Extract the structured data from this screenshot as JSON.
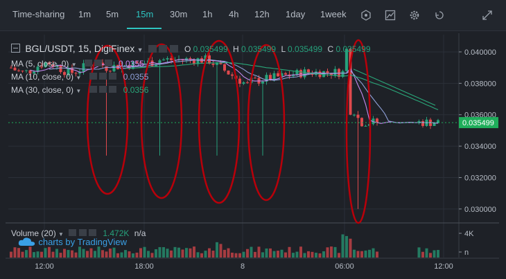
{
  "toolbar": {
    "timeframes": [
      "Time-sharing",
      "1m",
      "5m",
      "15m",
      "30m",
      "1h",
      "4h",
      "12h",
      "1day",
      "1week"
    ],
    "active": "15m",
    "icons": [
      "hexagon-icon",
      "chart-line-icon",
      "gear-icon",
      "undo-icon",
      "expand-icon"
    ]
  },
  "legend": {
    "symbol": "BGL/USDT, 15, DigiFinex",
    "o_label": "O",
    "o": "0.035499",
    "h_label": "H",
    "h": "0.035499",
    "l_label": "L",
    "l": "0.035499",
    "c_label": "C",
    "c": "0.035499",
    "ma5": "MA (5, close, 0)",
    "ma5_val": "0.0355",
    "ma10": "MA (10, close, 0)",
    "ma10_val": "0.0355",
    "ma30": "MA (30, close, 0)",
    "ma30_val": "0.0356",
    "volume": "Volume (20)",
    "volume_val": "1.472K",
    "volume_na": "n/a",
    "watermark": "charts by TradingView"
  },
  "colors": {
    "up": "#26a17b",
    "down": "#e0494d",
    "ma5": "#c58af0",
    "ma10": "#8fa0d8",
    "ma30": "#2aa87a",
    "annotation": "#b8000a",
    "last_price": "#1fae5b"
  },
  "chart_data": {
    "type": "candlestick",
    "y_ticks": [
      "0.040000",
      "0.038000",
      "0.036000",
      "0.034000",
      "0.032000",
      "0.030000"
    ],
    "last_price": "0.035499",
    "x_ticks": [
      "12:00",
      "18:00",
      "8",
      "06:00",
      "12:00"
    ],
    "volume_ticks": [
      "4K",
      "n"
    ],
    "ylim": [
      0.0292,
      0.0411
    ],
    "annotation_ellipses": 5
  }
}
